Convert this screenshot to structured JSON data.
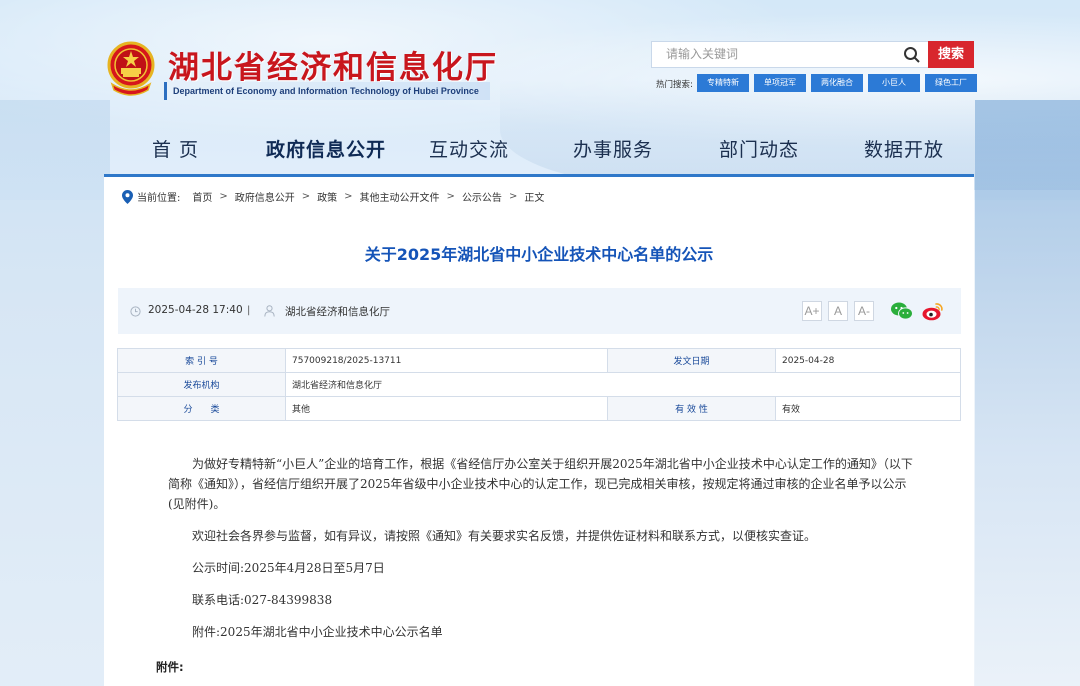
{
  "header": {
    "site_title": "湖北省经济和信息化厅",
    "site_subtitle": "Department of Economy and Information Technology of Hubei Province",
    "search_placeholder": "请输入关键词",
    "search_button": "搜索",
    "hot_label": "热门搜索:",
    "hot_tags": [
      "专精特新",
      "单项冠军",
      "两化融合",
      "小巨人",
      "绿色工厂"
    ]
  },
  "nav": {
    "items": [
      "首 页",
      "政府信息公开",
      "互动交流",
      "办事服务",
      "部门动态",
      "数据开放"
    ],
    "active_index": 1
  },
  "breadcrumb": {
    "label": "当前位置:",
    "items": [
      "首页",
      "政府信息公开",
      "政策",
      "其他主动公开文件",
      "公示公告",
      "正文"
    ],
    "separator": ">"
  },
  "article": {
    "title": "关于2025年湖北省中小企业技术中心名单的公示",
    "datetime": "2025-04-28 17:40",
    "divider": "|",
    "source": "湖北省经济和信息化厅",
    "font_buttons": [
      "A+",
      "A",
      "A-"
    ]
  },
  "info_table": {
    "index_label": "索 引 号",
    "index_value": "757009218/2025-13711",
    "date_label": "发文日期",
    "date_value": "2025-04-28",
    "org_label": "发布机构",
    "org_value": "湖北省经济和信息化厅",
    "category_label": "分　　类",
    "category_value": "其他",
    "validity_label": "有 效 性",
    "validity_value": "有效"
  },
  "body": {
    "p1": "为做好专精特新“小巨人”企业的培育工作，根据《省经信厅办公室关于组织开展2025年湖北省中小企业技术中心认定工作的通知》（以下简称《通知》），省经信厅组织开展了2025年省级中小企业技术中心的认定工作，现已完成相关审核，按规定将通过审核的企业名单予以公示(见附件)。",
    "p2": "欢迎社会各界参与监督，如有异议，请按照《通知》有关要求实名反馈，并提供佐证材料和联系方式，以便核实查证。",
    "p3": "公示时间:2025年4月28日至5月7日",
    "p4": "联系电话:027-84399838",
    "p5": "附件:2025年湖北省中小企业技术中心公示名单",
    "attach_head": "附件:"
  },
  "colors": {
    "brand_red": "#c8161d",
    "nav_line": "#2f78c9",
    "title_blue": "#1554b8",
    "tag_blue": "#2c7ad6",
    "search_red": "#d8262d"
  }
}
